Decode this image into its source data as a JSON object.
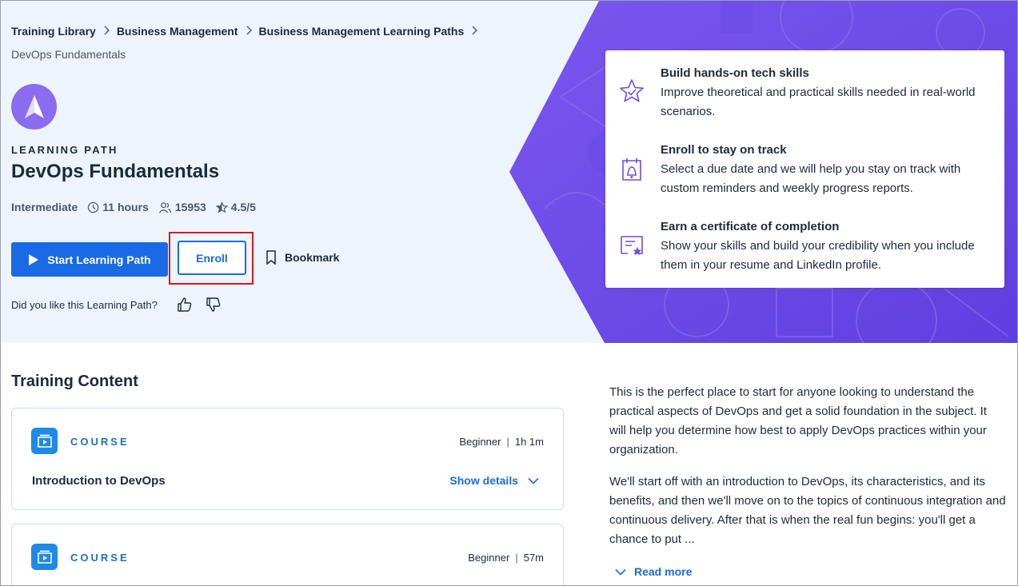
{
  "breadcrumb": {
    "items": [
      "Training Library",
      "Business Management",
      "Business Management Learning Paths"
    ],
    "current": "DevOps Fundamentals"
  },
  "path": {
    "eyebrow": "LEARNING PATH",
    "title": "DevOps Fundamentals",
    "level": "Intermediate",
    "duration": "11 hours",
    "learners": "15953",
    "rating": "4.5/5"
  },
  "actions": {
    "start_label": "Start Learning Path",
    "enroll_label": "Enroll",
    "bookmark_label": "Bookmark"
  },
  "feedback": {
    "question": "Did you like this Learning Path?"
  },
  "benefits": [
    {
      "icon": "star-check-icon",
      "title": "Build hands-on tech skills",
      "description": "Improve theoretical and practical skills needed in real-world scenarios."
    },
    {
      "icon": "calendar-bell-icon",
      "title": "Enroll to stay on track",
      "description": "Select a due date and we will help you stay on track with custom reminders and weekly progress reports."
    },
    {
      "icon": "certificate-icon",
      "title": "Earn a certificate of completion",
      "description": "Show your skills and build your credibility when you include them in your resume and LinkedIn profile."
    }
  ],
  "content": {
    "title": "Training Content",
    "items": [
      {
        "type": "COURSE",
        "level": "Beginner",
        "duration": "1h 1m",
        "name": "Introduction to DevOps",
        "details_label": "Show details"
      },
      {
        "type": "COURSE",
        "level": "Beginner",
        "duration": "57m",
        "name": "",
        "details_label": ""
      }
    ]
  },
  "description": {
    "paragraphs": [
      "This is the perfect place to start for anyone looking to understand the practical aspects of DevOps and get a solid foundation in the subject. It will help you determine how best to apply DevOps practices within your organization.",
      "We'll start off with an introduction to DevOps, its characteristics, and its benefits, and then we'll move on to the topics of continuous integration and continuous delivery. After that is when the real fun begins: you'll get a chance to put ..."
    ],
    "read_more_label": "Read more"
  },
  "colors": {
    "primary": "#1a6ae6",
    "hero_bg": "#eef4fb",
    "accent_purple": "#6f4ce8",
    "highlight": "#e0141e"
  }
}
